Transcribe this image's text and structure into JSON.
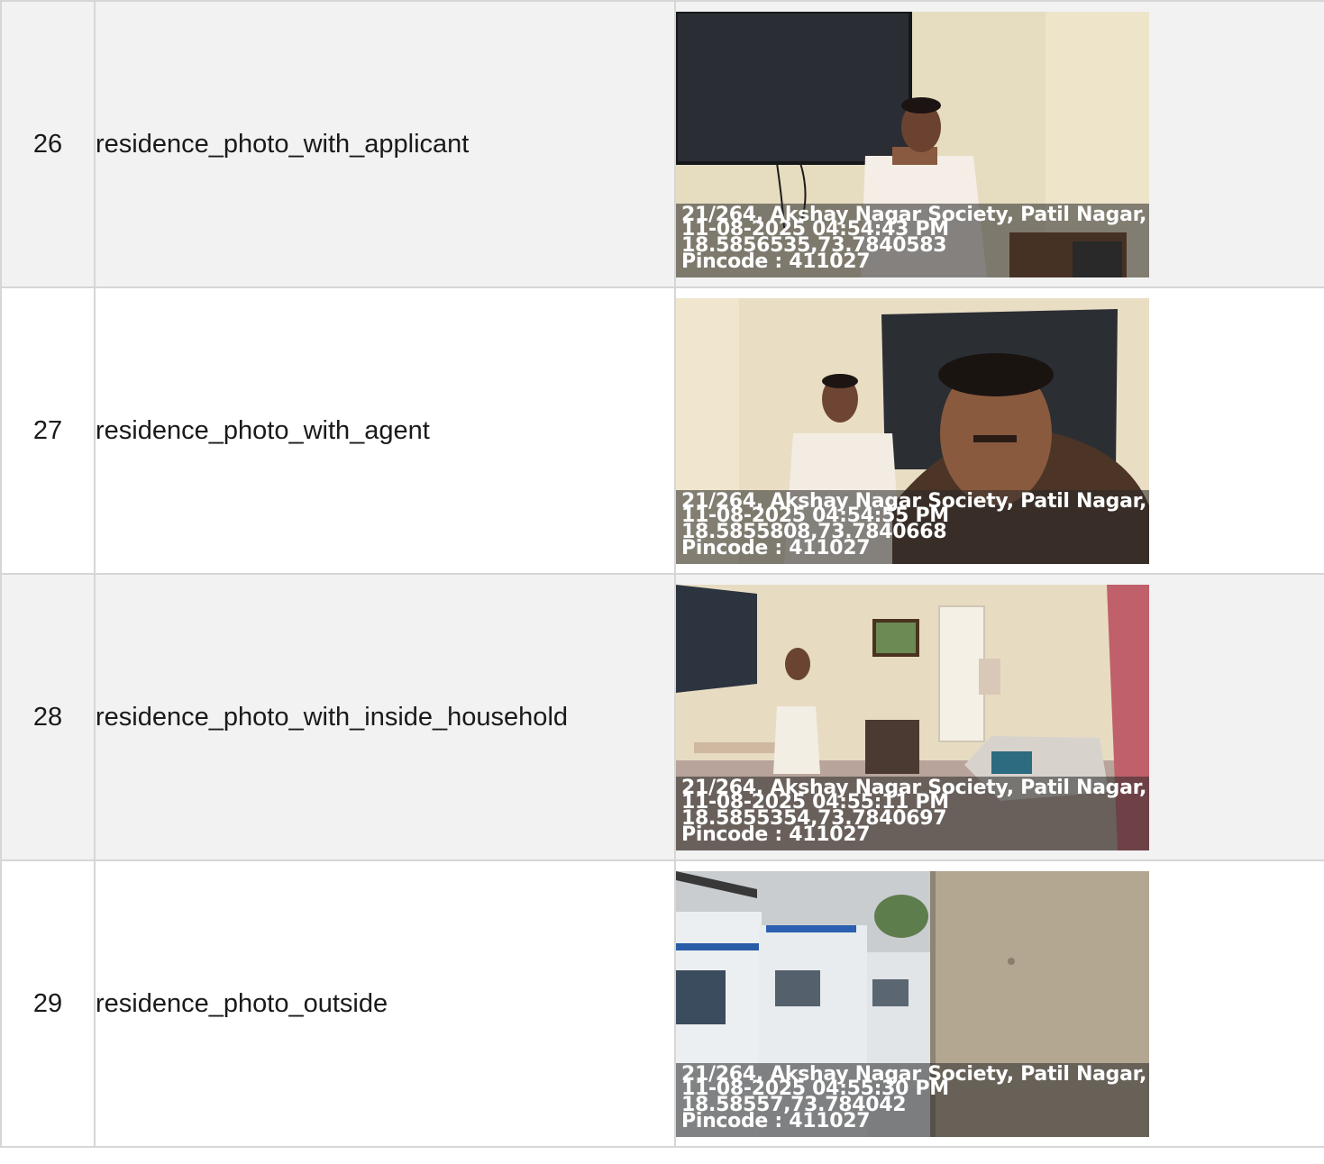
{
  "rows": [
    {
      "no": "26",
      "name": "residence_photo_with_applicant",
      "stamp": {
        "address": "21/264, Akshay Nagar Society, Patil Nagar, .",
        "datetime": "11-08-2025 04:54:43 PM",
        "coords": "18.5856535,73.7840583",
        "pincode": "Pincode : 411027"
      }
    },
    {
      "no": "27",
      "name": "residence_photo_with_agent",
      "stamp": {
        "address": "21/264, Akshay Nagar Society, Patil Nagar, .",
        "datetime": "11-08-2025 04:54:55 PM",
        "coords": "18.5855808,73.7840668",
        "pincode": "Pincode : 411027"
      }
    },
    {
      "no": "28",
      "name": "residence_photo_with_inside_household",
      "stamp": {
        "address": "21/264, Akshay Nagar Society, Patil Nagar, .",
        "datetime": "11-08-2025 04:55:11 PM",
        "coords": "18.5855354,73.7840697",
        "pincode": "Pincode : 411027"
      }
    },
    {
      "no": "29",
      "name": "residence_photo_outside",
      "stamp": {
        "address": "21/264, Akshay Nagar Society, Patil Nagar, .",
        "datetime": "11-08-2025 04:55:30 PM",
        "coords": "18.58557,73.784042",
        "pincode": "Pincode : 411027"
      }
    }
  ],
  "colors": {
    "border": "#d6d6d6",
    "row_shade": "#f2f2f2",
    "text": "#1a1a1a"
  }
}
